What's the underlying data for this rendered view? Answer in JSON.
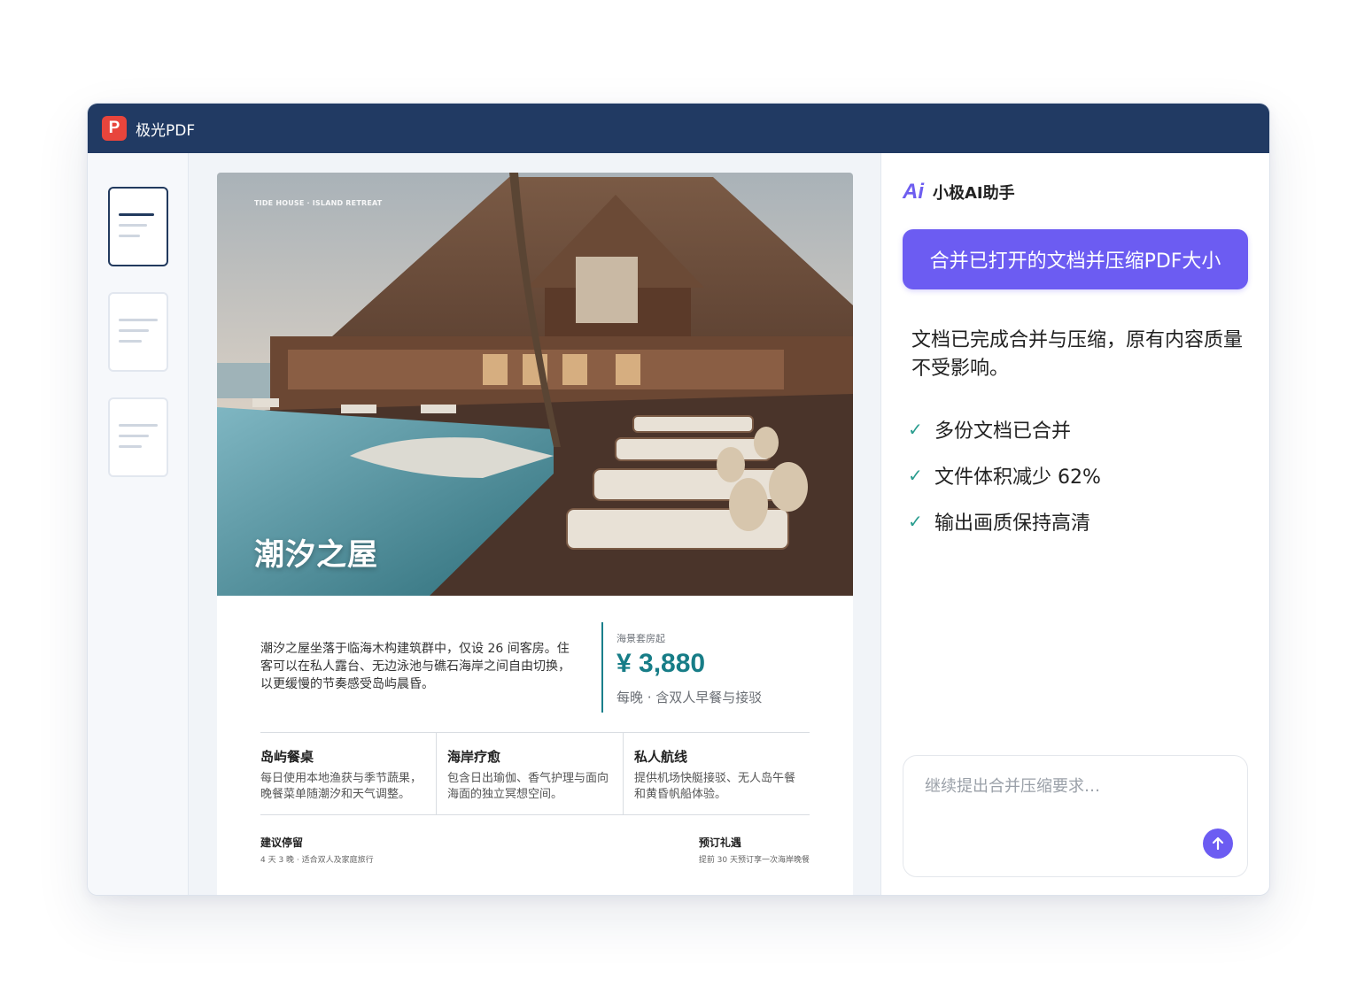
{
  "app": {
    "logo_letter": "P",
    "title": "极光PDF"
  },
  "document": {
    "hero_tag": "TIDE HOUSE · ISLAND RETREAT",
    "hero_title": "潮汐之屋",
    "description": "潮汐之屋坐落于临海木构建筑群中，仅设 26 间客房。住客可以在私人露台、无边泳池与礁石海岸之间自由切换，以更缓慢的节奏感受岛屿晨昏。",
    "price": {
      "caption": "海景套房起",
      "value": "¥ 3,880",
      "note": "每晚 · 含双人早餐与接驳"
    },
    "features": [
      {
        "title": "岛屿餐桌",
        "text": "每日使用本地渔获与季节蔬果，晚餐菜单随潮汐和天气调整。"
      },
      {
        "title": "海岸疗愈",
        "text": "包含日出瑜伽、香气护理与面向海面的独立冥想空间。"
      },
      {
        "title": "私人航线",
        "text": "提供机场快艇接驳、无人岛午餐和黄昏帆船体验。"
      }
    ],
    "footer_left": {
      "title": "建议停留",
      "sub": "4 天 3 晚 · 适合双人及家庭旅行"
    },
    "footer_right": {
      "title": "预订礼遇",
      "sub": "提前 30 天预订享一次海岸晚餐"
    }
  },
  "assistant": {
    "logo": "Ai",
    "title": "小极AI助手",
    "user_message": "合并已打开的文档并压缩PDF大小",
    "reply": "文档已完成合并与压缩，原有内容质量不受影响。",
    "checks": [
      "多份文档已合并",
      "文件体积减少 62%",
      "输出画质保持高清"
    ],
    "check_mark": "✓",
    "input_placeholder": "继续提出合并压缩要求…"
  },
  "colors": {
    "titlebar": "#213a63",
    "brand_red": "#e8453c",
    "accent_purple": "#6c5cf2",
    "price_teal": "#177d87",
    "check_green": "#2a9d8f"
  },
  "icons": [
    "app-logo-icon",
    "document-thumbnail-icon",
    "ai-logo-icon",
    "check-icon",
    "send-arrow-up-icon"
  ]
}
